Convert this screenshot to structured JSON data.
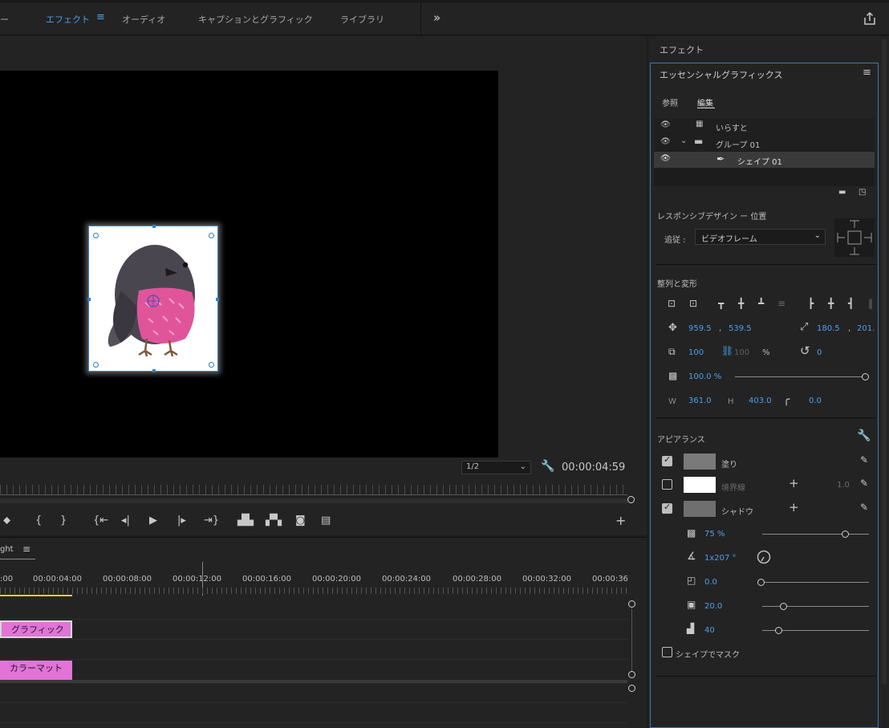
{
  "workspaces": {
    "tabs": [
      {
        "label": "ー",
        "active": false
      },
      {
        "label": "エフェクト",
        "active": true
      },
      {
        "label": "オーディオ",
        "active": false
      },
      {
        "label": "キャプションとグラフィック",
        "active": false
      },
      {
        "label": "ライブラリ",
        "active": false
      }
    ],
    "more_label": "»"
  },
  "monitor": {
    "zoom": "1/2",
    "timecode": "00:00:04:59"
  },
  "timeline": {
    "sequence_name": "ght",
    "timecodes": [
      ":00",
      "00:00:04:00",
      "00:00:08:00",
      "00:00:12:00",
      "00:00:16:00",
      "00:00:20:00",
      "00:00:24:00",
      "00:00:28:00",
      "00:00:32:00",
      "00:00:36"
    ],
    "clips": [
      {
        "label": "グラフィック"
      },
      {
        "label": "カラーマット"
      }
    ]
  },
  "effects_panel": {
    "title": "エフェクト"
  },
  "essential_graphics": {
    "title": "エッセンシャルグラフィックス",
    "tabs": [
      {
        "label": "参照",
        "active": false
      },
      {
        "label": "編集",
        "active": true
      }
    ],
    "layers": [
      {
        "name": "いらすと",
        "type": "image"
      },
      {
        "name": "グループ 01",
        "type": "group"
      },
      {
        "name": "シェイプ 01",
        "type": "shape",
        "selected": true
      }
    ],
    "responsive": {
      "title": "レスポンシブデザイン ー 位置",
      "follow_label": "追従 :",
      "follow_value": "ビデオフレーム"
    },
    "align": {
      "title": "整列と変形",
      "pos_x": "959.5",
      "pos_y": "539.5",
      "anchor_x": "180.5",
      "anchor_y": "201.",
      "scale": "100",
      "scale_linked": "100",
      "scale_unit": "%",
      "rotation": "0",
      "opacity": "100.0 %",
      "w_label": "W",
      "w": "361.0",
      "h_label": "H",
      "h": "403.0",
      "corner": "0.0",
      "comma": ","
    },
    "appearance": {
      "title": "アピアランス",
      "fill": {
        "label": "塗り",
        "checked": true,
        "color": "#7a7a7a"
      },
      "stroke": {
        "label": "境界線",
        "checked": false,
        "color": "#ffffff",
        "width": "1.0"
      },
      "shadow": {
        "label": "シャドウ",
        "checked": true,
        "color": "#6f6f6f"
      },
      "shadow_opacity": "75 %",
      "shadow_angle": "1x207 °",
      "shadow_distance": "0.0",
      "shadow_size": "20.0",
      "shadow_blur": "40",
      "mask_label": "シェイプでマスク"
    }
  }
}
